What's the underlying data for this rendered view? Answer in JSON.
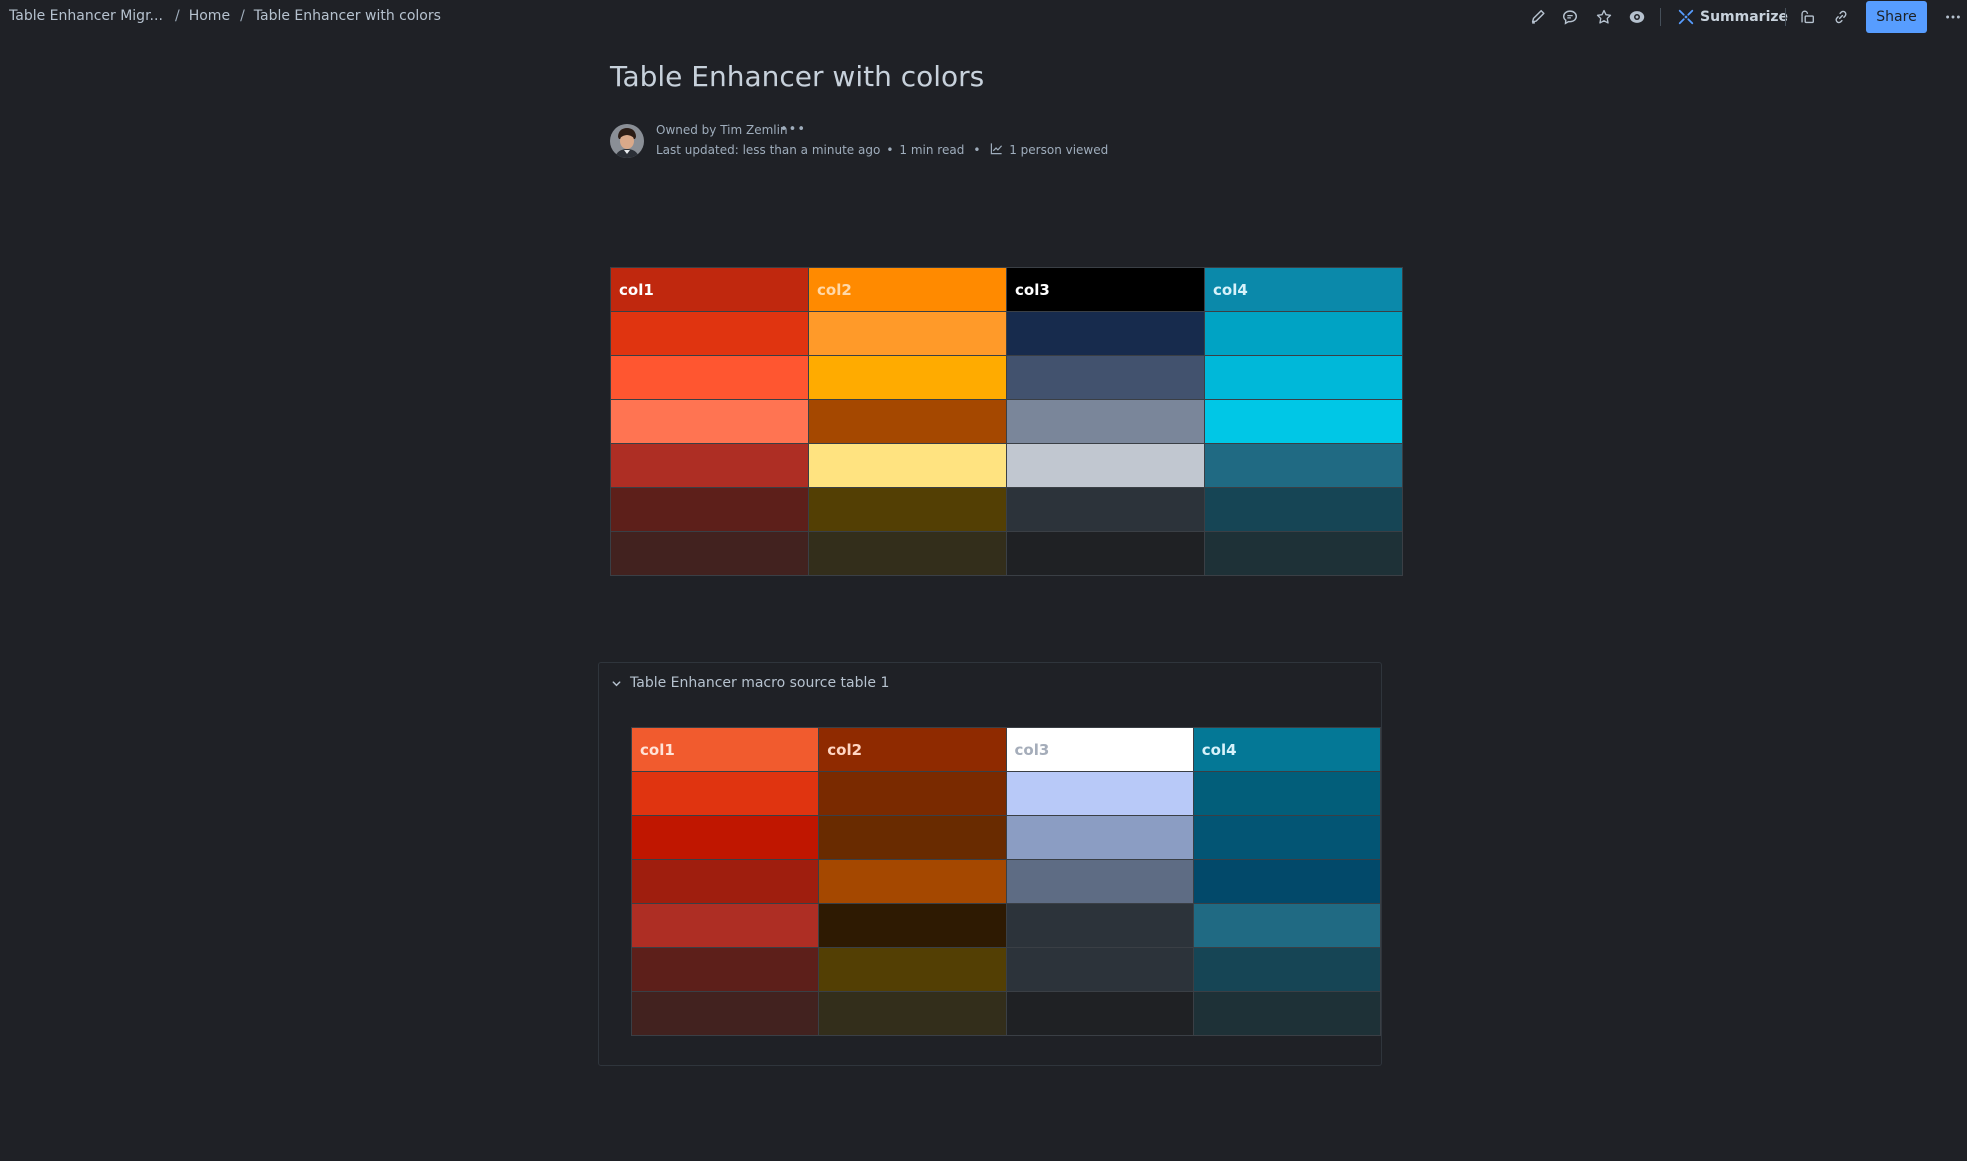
{
  "breadcrumb": {
    "space": "Table Enhancer Migr...",
    "home": "Home",
    "current": "Table Enhancer with colors"
  },
  "toolbar": {
    "summarize_label": "Summarize",
    "share_label": "Share",
    "icons": [
      "edit-icon",
      "comment-icon",
      "star-icon",
      "watch-icon",
      "summarize-icon",
      "restrictions-icon",
      "link-icon",
      "more-icon"
    ]
  },
  "page": {
    "title": "Table Enhancer with colors",
    "owner_text": "Owned by Tim Zemlin",
    "updated_text": "Last updated: less than a minute ago",
    "read_time": "1 min read",
    "views": "1 person viewed"
  },
  "table1": {
    "headers": [
      {
        "label": "col1",
        "bg": "#c0280e",
        "fg": "#ffffff"
      },
      {
        "label": "col2",
        "bg": "#ff8a00",
        "fg": "#ffd8a8"
      },
      {
        "label": "col3",
        "bg": "#000000",
        "fg": "#ffffff"
      },
      {
        "label": "col4",
        "bg": "#0b89aa",
        "fg": "#d7f2fa"
      }
    ],
    "rows": [
      [
        "#e03410",
        "#ff9a29",
        "#172b4d",
        "#00a3c4"
      ],
      [
        "#ff5630",
        "#ffab00",
        "#42526e",
        "#00b8d9"
      ],
      [
        "#ff7452",
        "#a54800",
        "#7a869a",
        "#00c7e6"
      ],
      [
        "#ae2e24",
        "#ffe380",
        "#c1c7d0",
        "#206a83"
      ],
      [
        "#5d1f1a",
        "#533f04",
        "#2c333a",
        "#164555"
      ],
      [
        "#42221f",
        "#332e1b",
        "#1f2124",
        "#1e3137"
      ]
    ]
  },
  "macro": {
    "title": "Table Enhancer macro source table 1",
    "table": {
      "headers": [
        {
          "label": "col1",
          "bg": "#f15b2e",
          "fg": "#ffe3d8"
        },
        {
          "label": "col2",
          "bg": "#8f2a00",
          "fg": "#ffd5c2"
        },
        {
          "label": "col3",
          "bg": "#ffffff",
          "fg": "#a5adba"
        },
        {
          "label": "col4",
          "bg": "#047896",
          "fg": "#d7f2fa"
        }
      ],
      "rows": [
        [
          "#e03410",
          "#7a2a00",
          "#b8c9f8",
          "#025e7a"
        ],
        [
          "#c01600",
          "#692b00",
          "#8b9dc3",
          "#035574"
        ],
        [
          "#9f1e0e",
          "#a54800",
          "#5e6c84",
          "#02496a"
        ],
        [
          "#ae2e24",
          "#2e1a02",
          "#2c333a",
          "#206a83"
        ],
        [
          "#5d1f1a",
          "#533f04",
          "#2c333a",
          "#164555"
        ],
        [
          "#42221f",
          "#332e1b",
          "#1f2124",
          "#1e3137"
        ]
      ]
    }
  }
}
